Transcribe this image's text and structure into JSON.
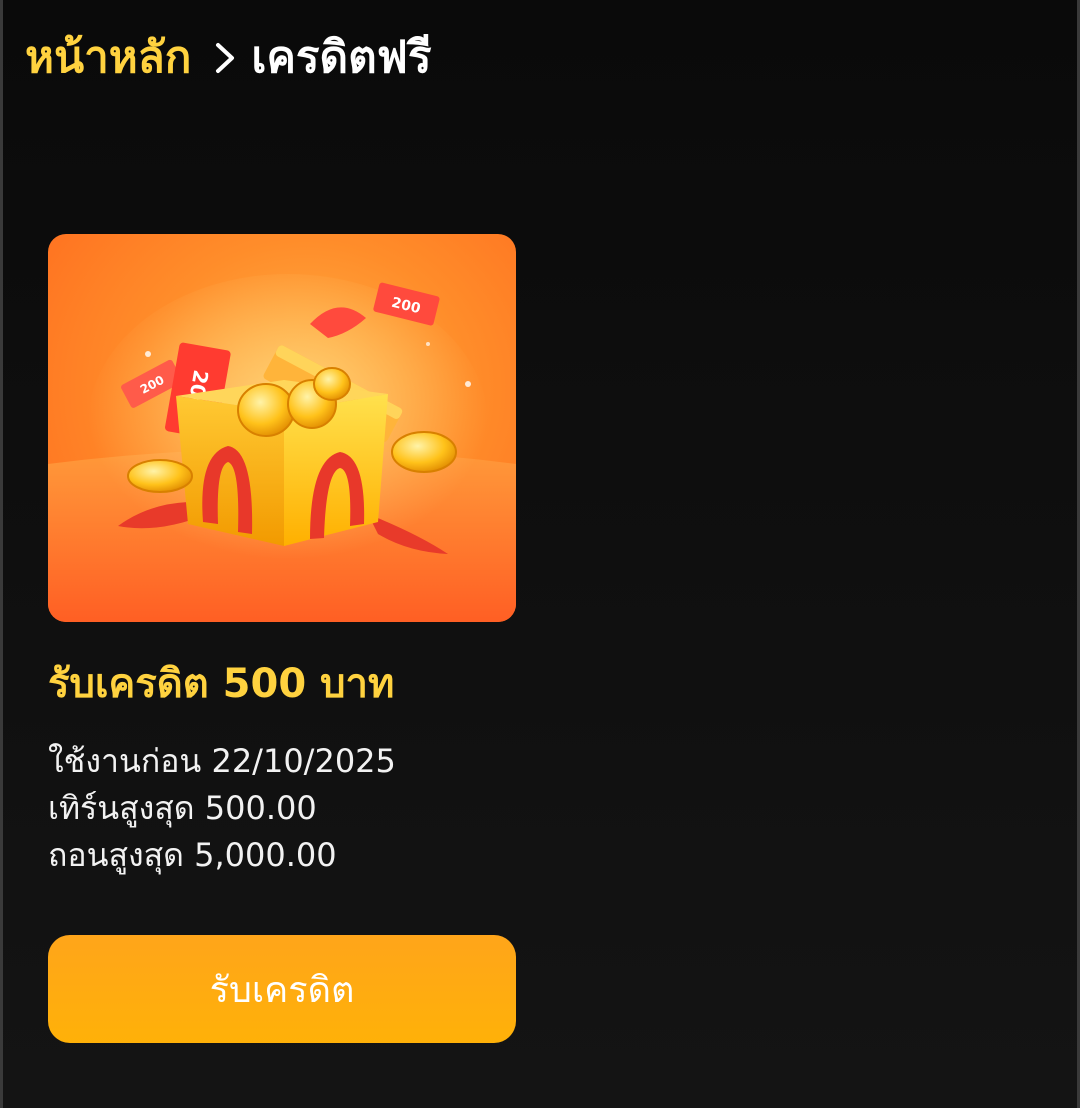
{
  "breadcrumb": {
    "home_label": "หน้าหลัก",
    "current_label": "เครดิตฟรี",
    "separator_icon": "chevron-right-icon"
  },
  "promo": {
    "image_icon": "gift-box-coins-illustration",
    "ticket_value": "200",
    "title": "รับเครดิต 500 บาท",
    "details": [
      "ใช้งานก่อน 22/10/2025",
      "เทิร์นสูงสุด 500.00",
      "ถอนสูงสุด 5,000.00"
    ],
    "claim_button_label": "รับเครดิต"
  },
  "colors": {
    "background": "#0b0b0b",
    "accent_yellow": "#ffd23f",
    "button_orange": "#ffa51a",
    "image_orange": "#ff8d2a"
  }
}
